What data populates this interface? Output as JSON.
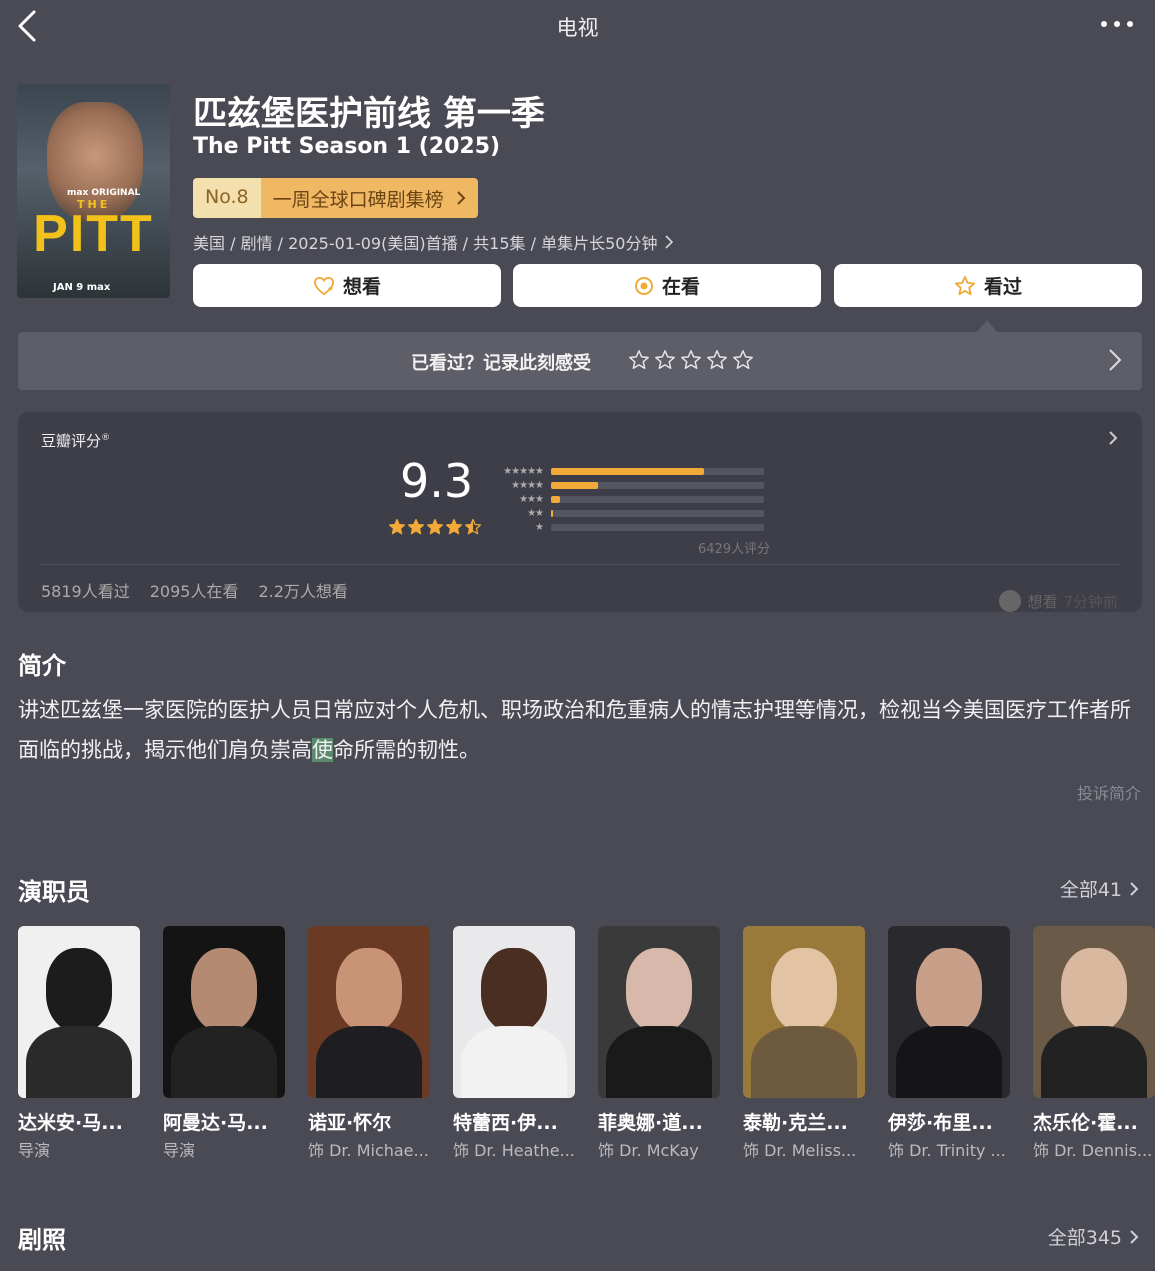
{
  "header": {
    "title": "电视",
    "back_icon": "chevron-left-icon",
    "more_icon": "ellipsis-icon"
  },
  "poster": {
    "brand": "max ORIGINAL",
    "the": "THE",
    "title": "PITT",
    "date": "JAN 9 max"
  },
  "show": {
    "title_cn": "匹兹堡医护前线 第一季",
    "title_en": "The Pitt Season 1 (2025)",
    "rank_no": "No.8",
    "rank_label": "一周全球口碑剧集榜",
    "meta": "美国 / 剧情 / 2025-01-09(美国)首播 / 共15集 / 单集片长50分钟"
  },
  "actions": {
    "want": "想看",
    "watching": "在看",
    "watched": "看过"
  },
  "record": {
    "text": "已看过？记录此刻感受"
  },
  "rating": {
    "label": "豆瓣评分",
    "score": "9.3",
    "score_stars": 4.5,
    "distribution": [
      0.72,
      0.22,
      0.04,
      0.01,
      0.0
    ],
    "count": "6429人评分",
    "watched": "5819人看过",
    "watching": "2095人在看",
    "want": "2.2万人想看",
    "mini_action": "想看",
    "mini_note": "7分钟前"
  },
  "synopsis": {
    "title": "简介",
    "text_before": "讲述匹兹堡一家医院的医护人员日常应对个人危机、职场政治和危重病人的情志护理等情况，检视当今美国医疗工作者所面临的挑战，揭示他们肩负崇高",
    "text_highlight": "使",
    "text_after": "命所需的韧性。",
    "report": "投诉简介"
  },
  "cast": {
    "title": "演职员",
    "all": "全部41",
    "items": [
      {
        "name": "达米安·马...",
        "role": "导演"
      },
      {
        "name": "阿曼达·马...",
        "role": "导演"
      },
      {
        "name": "诺亚·怀尔",
        "role": "饰 Dr. Michae..."
      },
      {
        "name": "特蕾西·伊...",
        "role": "饰 Dr. Heathe..."
      },
      {
        "name": "菲奥娜·道...",
        "role": "饰 Dr. McKay"
      },
      {
        "name": "泰勒·克兰...",
        "role": "饰 Dr. Meliss..."
      },
      {
        "name": "伊莎·布里...",
        "role": "饰 Dr. Trinity ..."
      },
      {
        "name": "杰乐伦·霍...",
        "role": "饰 Dr. Dennis..."
      }
    ]
  },
  "stills": {
    "title": "剧照",
    "all": "全部345"
  },
  "colors": {
    "accent": "#f1a937",
    "background": "#4a4a55",
    "card": "#3e3e48"
  }
}
